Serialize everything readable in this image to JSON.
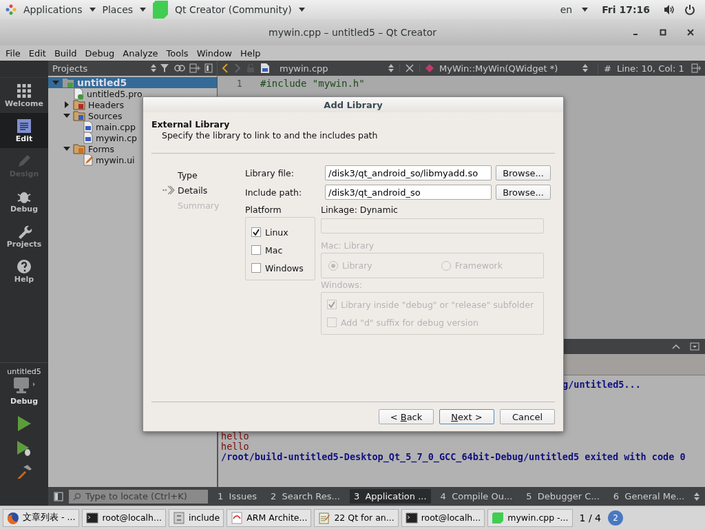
{
  "top_bar": {
    "apps_menu": "Applications",
    "places_menu": "Places",
    "app_menu": "Qt Creator (Community)",
    "keyboard": "en",
    "clock": "Fri 17:16"
  },
  "window": {
    "title": "mywin.cpp – untitled5 – Qt Creator"
  },
  "menu": [
    "File",
    "Edit",
    "Build",
    "Debug",
    "Analyze",
    "Tools",
    "Window",
    "Help"
  ],
  "mode_bar": [
    {
      "label": "Welcome",
      "kind": "welcome",
      "selected": false,
      "disabled": false
    },
    {
      "label": "Edit",
      "kind": "edit",
      "selected": true,
      "disabled": false
    },
    {
      "label": "Design",
      "kind": "design",
      "selected": false,
      "disabled": true
    },
    {
      "label": "Debug",
      "kind": "debug",
      "selected": false,
      "disabled": false
    },
    {
      "label": "Projects",
      "kind": "projects",
      "selected": false,
      "disabled": false
    },
    {
      "label": "Help",
      "kind": "help",
      "selected": false,
      "disabled": false
    }
  ],
  "kit": {
    "project": "untitled5",
    "build": "Debug"
  },
  "projects_panel": {
    "title": "Projects",
    "tree": [
      {
        "label": "untitled5",
        "kind": "project",
        "expanded": true,
        "selected": true,
        "children": [
          {
            "label": "untitled5.pro",
            "kind": "pro",
            "selected": false
          },
          {
            "label": "Headers",
            "kind": "headers",
            "expanded": false,
            "selected": false
          },
          {
            "label": "Sources",
            "kind": "sources",
            "expanded": true,
            "selected": false,
            "children": [
              {
                "label": "main.cpp",
                "kind": "cpp",
                "selected": false
              },
              {
                "label": "mywin.cp",
                "kind": "cpp",
                "selected": false
              }
            ]
          },
          {
            "label": "Forms",
            "kind": "forms",
            "expanded": true,
            "selected": false,
            "children": [
              {
                "label": "mywin.ui",
                "kind": "ui",
                "selected": false
              }
            ]
          }
        ]
      }
    ]
  },
  "editor": {
    "file": "mywin.cpp",
    "symbol": "MyWin::MyWin(QWidget *)",
    "hash": "#",
    "position": "Line: 10, Col: 1",
    "lines": [
      {
        "number": "1",
        "code": "#include \"mywin.h\""
      }
    ]
  },
  "output": {
    "lines": [
      {
        "kind": "cut",
        "text": "g/untitled5..."
      },
      {
        "kind": "stdout",
        "text": "hello"
      },
      {
        "kind": "stdout",
        "text": "hello"
      },
      {
        "kind": "status",
        "text": "/root/build-untitled5-Desktop_Qt_5_7_0_GCC_64bit-Debug/untitled5 exited with code 0"
      }
    ]
  },
  "status_bar": {
    "locator_placeholder": "Type to locate (Ctrl+K)",
    "tabs": [
      {
        "number": "1",
        "label": "Issues",
        "selected": false
      },
      {
        "number": "2",
        "label": "Search Res...",
        "selected": false
      },
      {
        "number": "3",
        "label": "Application ...",
        "selected": true
      },
      {
        "number": "4",
        "label": "Compile Ou...",
        "selected": false
      },
      {
        "number": "5",
        "label": "Debugger C...",
        "selected": false
      },
      {
        "number": "6",
        "label": "General Me...",
        "selected": false
      }
    ]
  },
  "taskbar": {
    "items": [
      {
        "kind": "browser",
        "label": "文章列表 - ..."
      },
      {
        "kind": "terminal",
        "label": "root@localh..."
      },
      {
        "kind": "files",
        "label": "include"
      },
      {
        "kind": "document",
        "label": "ARM Archite..."
      },
      {
        "kind": "editor",
        "label": "22 Qt for an..."
      },
      {
        "kind": "terminal",
        "label": "root@localh..."
      },
      {
        "kind": "qt",
        "label": "mywin.cpp -..."
      }
    ],
    "pager": "1 / 4",
    "badge": "2"
  },
  "dialog": {
    "title": "Add Library",
    "heading": "External Library",
    "subtitle": "Specify the library to link to and the includes path",
    "steps": [
      {
        "label": "Type",
        "current": false,
        "disabled": false
      },
      {
        "label": "Details",
        "current": true,
        "disabled": false
      },
      {
        "label": "Summary",
        "current": false,
        "disabled": true
      }
    ],
    "fields": [
      {
        "label": "Library file:",
        "value": "/disk3/qt_android_so/libmyadd.so",
        "button": "Browse..."
      },
      {
        "label": "Include path:",
        "value": "/disk3/qt_android_so",
        "button": "Browse..."
      }
    ],
    "platform": {
      "title": "Platform",
      "options": [
        {
          "label": "Linux",
          "checked": true
        },
        {
          "label": "Mac",
          "checked": false
        },
        {
          "label": "Windows",
          "checked": false
        }
      ]
    },
    "linkage": {
      "label": "Linkage: Dynamic"
    },
    "mac": {
      "label": "Mac: Library",
      "options": [
        {
          "label": "Library",
          "selected": true
        },
        {
          "label": "Framework",
          "selected": false
        }
      ]
    },
    "windows": {
      "label": "Windows:",
      "options": [
        {
          "label": "Library inside \"debug\" or \"release\" subfolder",
          "checked": true
        },
        {
          "label": "Add \"d\" suffix for debug version",
          "checked": false
        }
      ]
    },
    "buttons": [
      {
        "label": "< Back",
        "default": false
      },
      {
        "label": "Next >",
        "default": true
      },
      {
        "label": "Cancel",
        "default": false
      }
    ]
  }
}
